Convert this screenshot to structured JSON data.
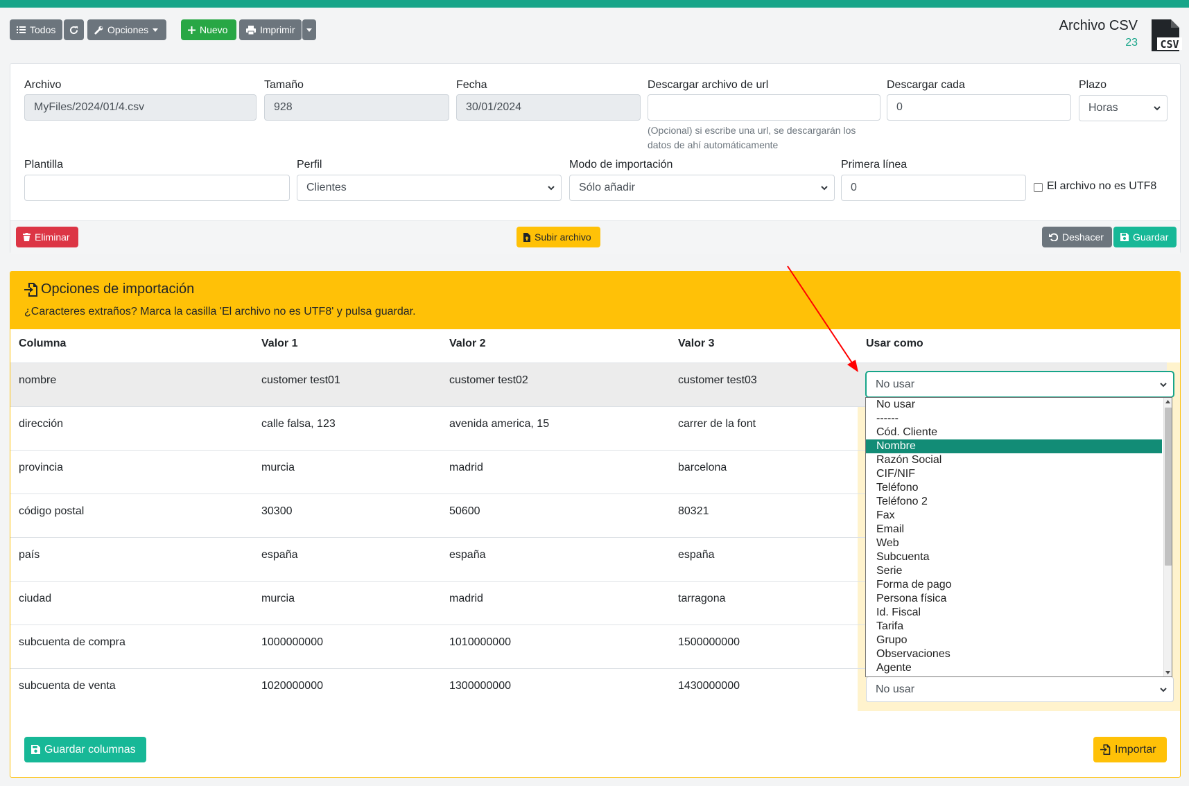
{
  "toolbar": {
    "todos_label": "Todos",
    "opciones_label": "Opciones",
    "nuevo_label": "Nuevo",
    "imprimir_label": "Imprimir"
  },
  "document": {
    "title": "Archivo CSV",
    "count": "23",
    "icon_text": "CSV"
  },
  "form": {
    "archivo_label": "Archivo",
    "archivo_value": "MyFiles/2024/01/4.csv",
    "tamano_label": "Tamaño",
    "tamano_value": "928",
    "fecha_label": "Fecha",
    "fecha_value": "30/01/2024",
    "url_label": "Descargar archivo de url",
    "url_value": "",
    "url_help": "(Opcional) si escribe una url, se descargarán los datos de ahí automáticamente",
    "descargar_cada_label": "Descargar cada",
    "descargar_cada_value": "0",
    "plazo_label": "Plazo",
    "plazo_value": "Horas",
    "plantilla_label": "Plantilla",
    "plantilla_value": "",
    "perfil_label": "Perfil",
    "perfil_value": "Clientes",
    "modo_label": "Modo de importación",
    "modo_value": "Sólo añadir",
    "primera_linea_label": "Primera línea",
    "primera_linea_value": "0",
    "utf8_label": "El archivo no es UTF8",
    "utf8_checked": false
  },
  "form_actions": {
    "eliminar_label": "Eliminar",
    "subir_label": "Subir archivo",
    "deshacer_label": "Deshacer",
    "guardar_label": "Guardar"
  },
  "import_options": {
    "title": "Opciones de importación",
    "subtitle": "¿Caracteres extraños? Marca la casilla 'El archivo no es UTF8' y pulsa guardar.",
    "headers": [
      "Columna",
      "Valor 1",
      "Valor 2",
      "Valor 3",
      "Usar como"
    ],
    "rows": [
      {
        "columna": "nombre",
        "v1": "customer test01",
        "v2": "customer test02",
        "v3": "customer test03",
        "usar": "No usar"
      },
      {
        "columna": "dirección",
        "v1": "calle falsa, 123",
        "v2": "avenida america, 15",
        "v3": "carrer de la font",
        "usar": ""
      },
      {
        "columna": "provincia",
        "v1": "murcia",
        "v2": "madrid",
        "v3": "barcelona",
        "usar": ""
      },
      {
        "columna": "código postal",
        "v1": "30300",
        "v2": "50600",
        "v3": "80321",
        "usar": ""
      },
      {
        "columna": "país",
        "v1": "españa",
        "v2": "españa",
        "v3": "españa",
        "usar": ""
      },
      {
        "columna": "ciudad",
        "v1": "murcia",
        "v2": "madrid",
        "v3": "tarragona",
        "usar": ""
      },
      {
        "columna": "subcuenta de compra",
        "v1": "1000000000",
        "v2": "1010000000",
        "v3": "1500000000",
        "usar": ""
      },
      {
        "columna": "subcuenta de venta",
        "v1": "1020000000",
        "v2": "1300000000",
        "v3": "1430000000",
        "usar": "No usar"
      }
    ],
    "dropdown_options": [
      "No usar",
      "------",
      "Cód. Cliente",
      "Nombre",
      "Razón Social",
      "CIF/NIF",
      "Teléfono",
      "Teléfono 2",
      "Fax",
      "Email",
      "Web",
      "Subcuenta",
      "Serie",
      "Forma de pago",
      "Persona física",
      "Id. Fiscal",
      "Tarifa",
      "Grupo",
      "Observaciones",
      "Agente"
    ],
    "dropdown_highlighted": "Nombre",
    "guardar_columnas_label": "Guardar columnas",
    "importar_label": "Importar"
  },
  "colors": {
    "accent": "#17a589",
    "warning": "#ffc107",
    "danger": "#dc3545",
    "success": "#28a745",
    "annotation_arrow": "#ff0000"
  },
  "icons": {
    "list": "list-icon",
    "refresh": "refresh-icon",
    "wrench": "wrench-icon",
    "plus": "plus-icon",
    "print": "print-icon",
    "trash": "trash-icon",
    "upload": "file-upload-icon",
    "undo": "undo-icon",
    "save": "save-icon",
    "import": "file-import-icon",
    "csv": "csv-file-icon"
  }
}
